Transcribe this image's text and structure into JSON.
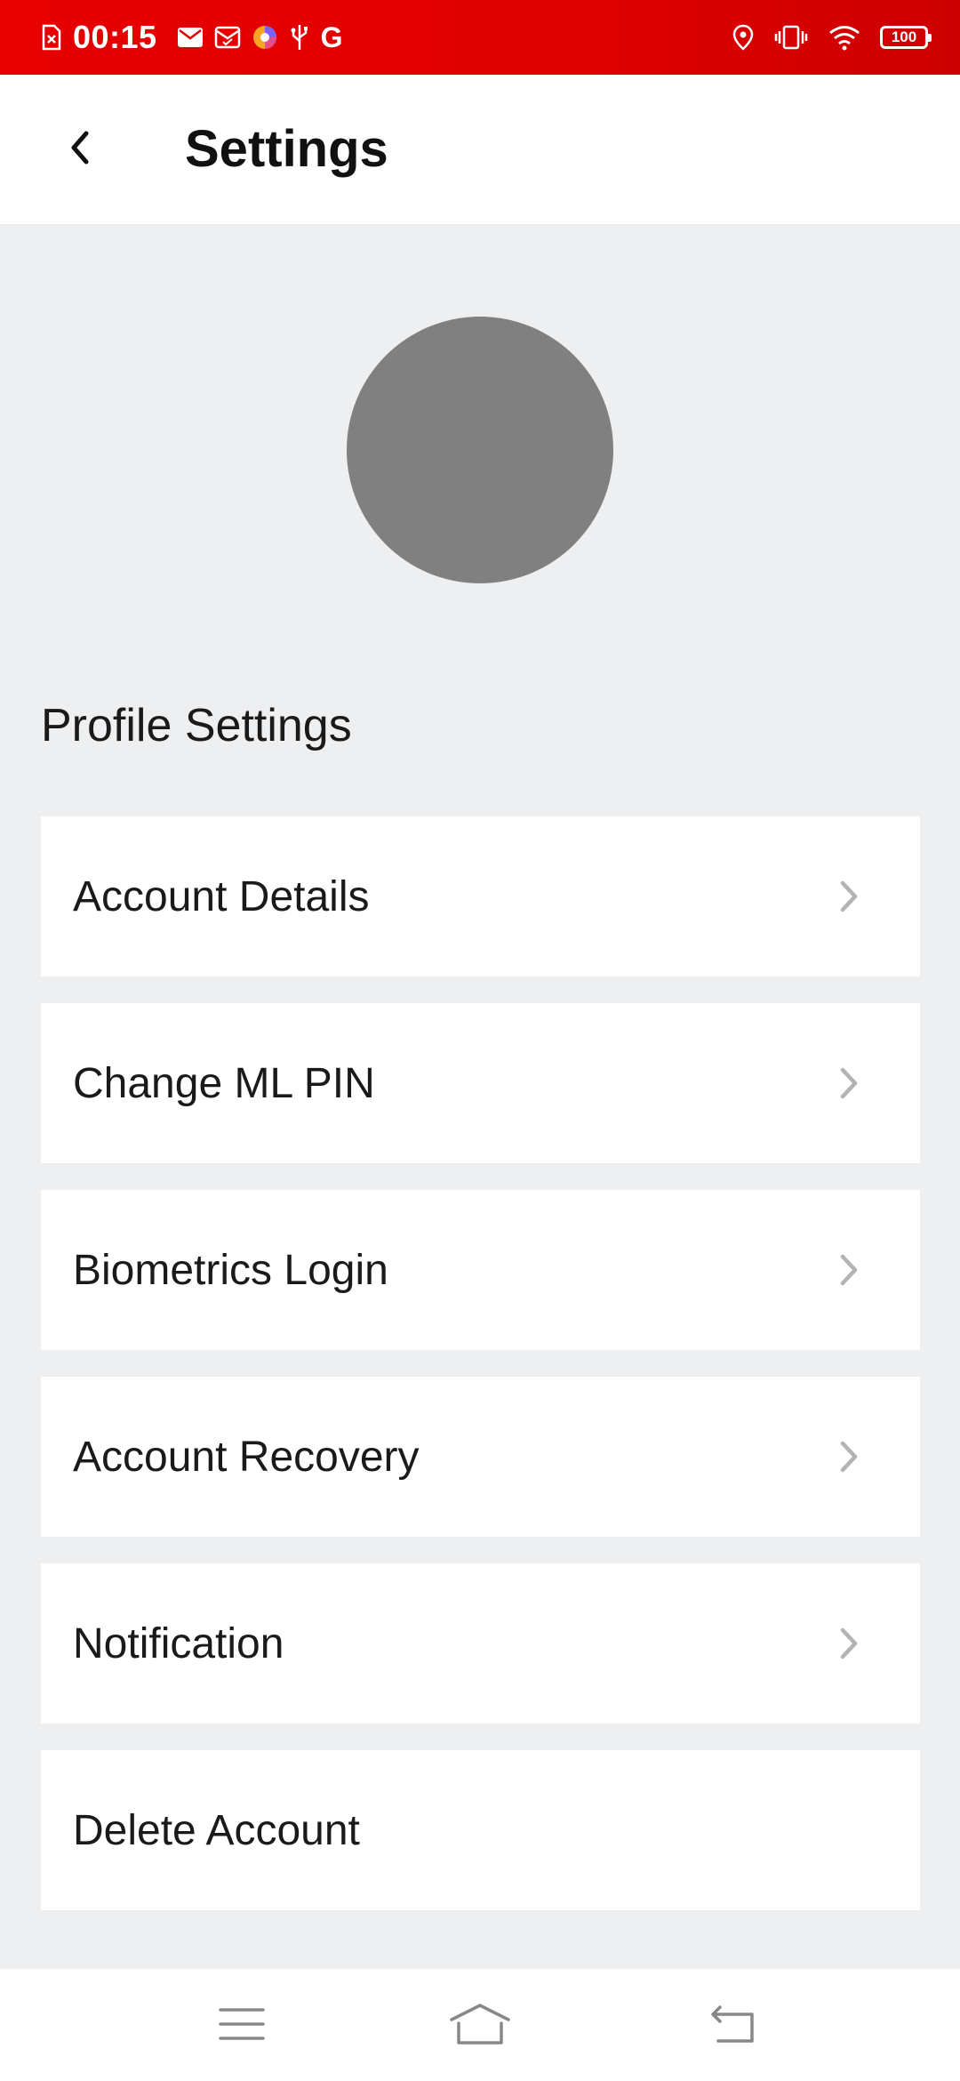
{
  "status_bar": {
    "time": "00:15",
    "battery": "100",
    "left_icons": [
      "file-x-icon",
      "mail-icon",
      "mail-check-icon",
      "browser-icon",
      "usb-icon",
      "google-icon"
    ],
    "right_icons": [
      "location-icon",
      "vibrate-icon",
      "wifi-icon",
      "battery-icon"
    ],
    "google_glyph": "G"
  },
  "header": {
    "title": "Settings"
  },
  "profile": {
    "section_title": "Profile Settings"
  },
  "settings_items": [
    {
      "label": "Account Details",
      "has_chevron": true
    },
    {
      "label": "Change ML PIN",
      "has_chevron": true
    },
    {
      "label": "Biometrics Login",
      "has_chevron": true
    },
    {
      "label": "Account Recovery",
      "has_chevron": true
    },
    {
      "label": "Notification",
      "has_chevron": true
    },
    {
      "label": "Delete Account",
      "has_chevron": false
    }
  ],
  "colors": {
    "status_bar": "#e60000",
    "background": "#eeeff1",
    "card": "#ffffff",
    "avatar": "#808080",
    "chevron": "#b3b3b3"
  }
}
